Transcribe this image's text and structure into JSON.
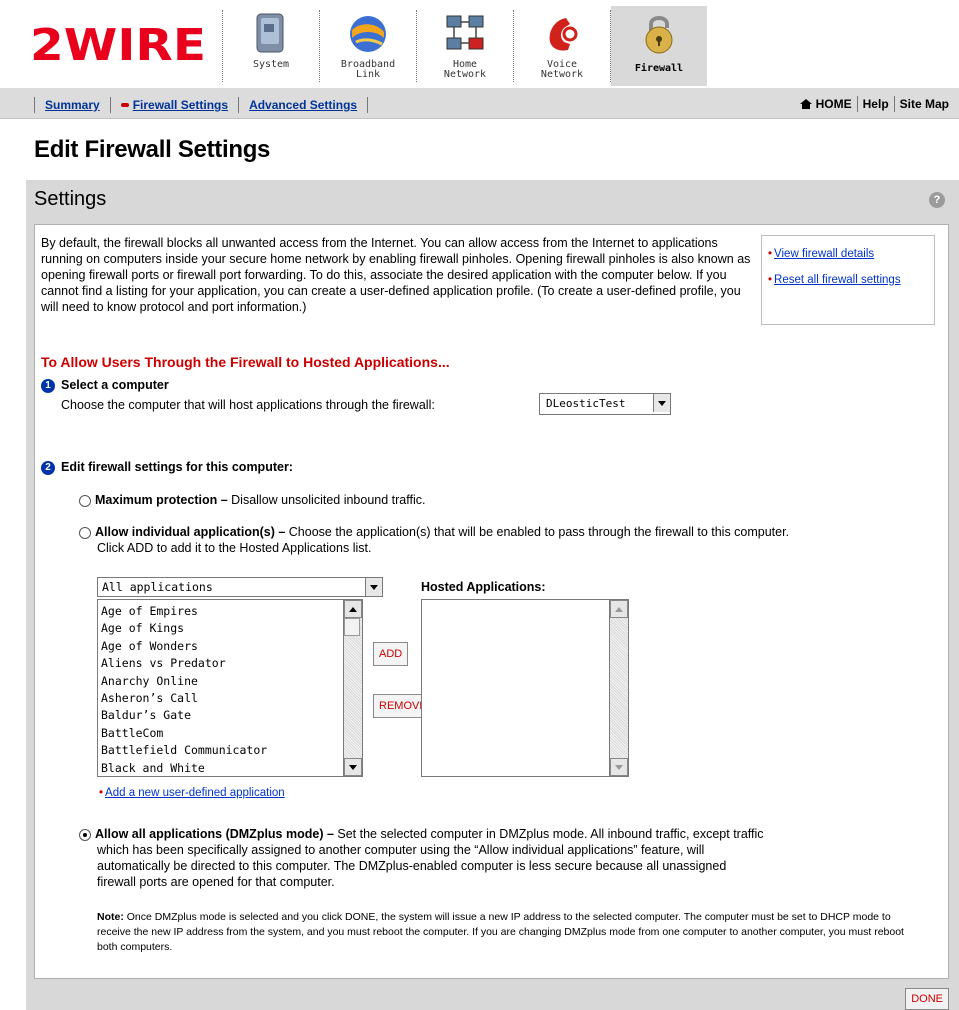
{
  "brand": {
    "logo_text": "2WIRE",
    "color": "#e8001c"
  },
  "nav": {
    "tabs": [
      {
        "label_lines": [
          "System"
        ],
        "icon": "system-icon",
        "active": false
      },
      {
        "label_lines": [
          "Broadband",
          "Link"
        ],
        "icon": "globe-icon",
        "active": false
      },
      {
        "label_lines": [
          "Home",
          "Network"
        ],
        "icon": "home-network-icon",
        "active": false
      },
      {
        "label_lines": [
          "Voice",
          "Network"
        ],
        "icon": "phone-icon",
        "active": false
      },
      {
        "label_lines": [
          "Firewall"
        ],
        "icon": "padlock-icon",
        "active": true
      }
    ]
  },
  "subnav": {
    "links": [
      "Summary",
      "Firewall Settings",
      "Advanced Settings"
    ],
    "active_index": 1,
    "right": [
      "HOME",
      "Help",
      "Site Map"
    ]
  },
  "page": {
    "title": "Edit Firewall Settings"
  },
  "panel": {
    "title": "Settings",
    "help_icon": "?",
    "intro": "By default, the firewall blocks all unwanted access from the Internet. You can allow access from the Internet to applications running on computers inside your secure home network by enabling firewall pinholes. Opening firewall pinholes is also known as opening firewall ports or firewall port forwarding. To do this, associate the desired application with the computer below. If you cannot find a listing for your application, you can create a user-defined application profile. (To create a user-defined profile, you will need to know protocol and port information.)",
    "side_links": [
      "View firewall details",
      "Reset all firewall settings"
    ],
    "section_heading": "To Allow Users Through the Firewall to Hosted Applications...",
    "step1": {
      "num": "1",
      "title": "Select a computer",
      "prompt": "Choose the computer that will host applications through the firewall:",
      "computer": "DLeosticTest"
    },
    "step2": {
      "num": "2",
      "title": "Edit firewall settings for this computer:",
      "options": [
        {
          "title": "Maximum protection –",
          "desc": " Disallow unsolicited inbound traffic.",
          "checked": false
        },
        {
          "title": "Allow individual application(s) –",
          "desc": " Choose the application(s) that will be enabled to pass through the firewall to this computer.",
          "desc2": "Click ADD to add it to the Hosted Applications list.",
          "checked": false
        },
        {
          "title": "Allow all applications (DMZplus mode) –",
          "desc": "  Set the selected computer in DMZplus mode. All inbound traffic, except traffic",
          "desc2": "which has been specifically assigned to another computer using the “Allow individual applications” feature, will",
          "desc3": "automatically be directed to this computer. The DMZplus-enabled computer is less secure because all unassigned",
          "desc4": "firewall ports are opened for that computer.",
          "checked": true
        }
      ]
    },
    "apps": {
      "category": "All applications",
      "list": [
        "Age of Empires",
        "Age of Kings",
        "Age of Wonders",
        "Aliens vs Predator",
        "Anarchy Online",
        "Asheron’s Call",
        "Baldur’s Gate",
        "BattleCom",
        "Battlefield Communicator",
        "Black and White"
      ],
      "add_label": "ADD",
      "remove_label": "REMOVE",
      "hosted_label": "Hosted Applications:",
      "hosted": [],
      "add_link": "Add a new user-defined application"
    },
    "note_label": "Note:",
    "note": " Once DMZplus mode is selected and you click DONE, the system will issue a new IP address to the selected computer. The computer must be set to DHCP mode to receive the new IP address from the system, and you must reboot the computer. If you are changing DMZplus mode from one computer to another computer, you must reboot both computers.",
    "done_label": "DONE"
  }
}
